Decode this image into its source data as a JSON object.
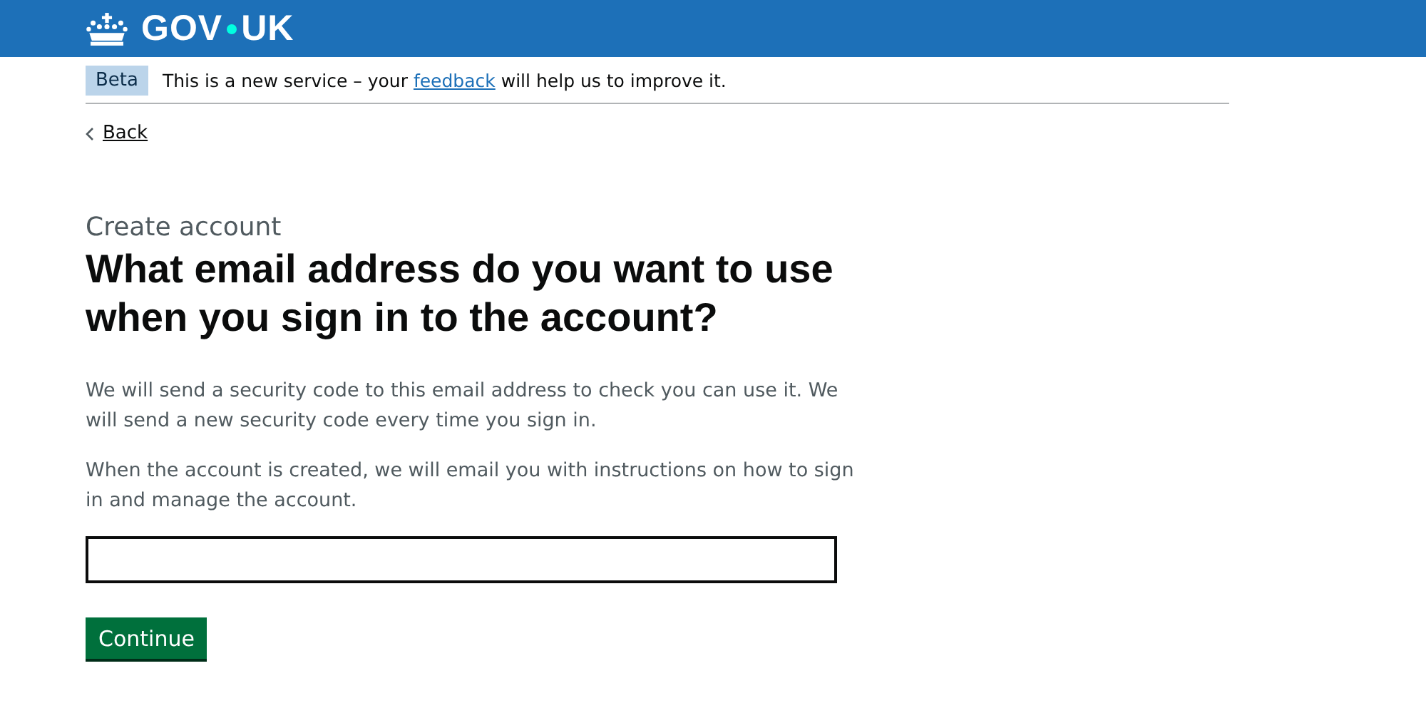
{
  "header": {
    "logo": {
      "left": "GOV",
      "right": "UK"
    }
  },
  "phase_banner": {
    "tag": "Beta",
    "text_before": "This is a new service – your ",
    "link": "feedback",
    "text_after": " will help us to improve it."
  },
  "back_link": "Back",
  "caption": "Create account",
  "heading": "What email address do you want to use when you sign in to the account?",
  "paragraphs": [
    "We will send a security code to this email address to check you can use it. We will send a new security code every time you sign in.",
    "When the account is created, we will email you with instructions on how to sign in and manage the account."
  ],
  "button": "Continue"
}
